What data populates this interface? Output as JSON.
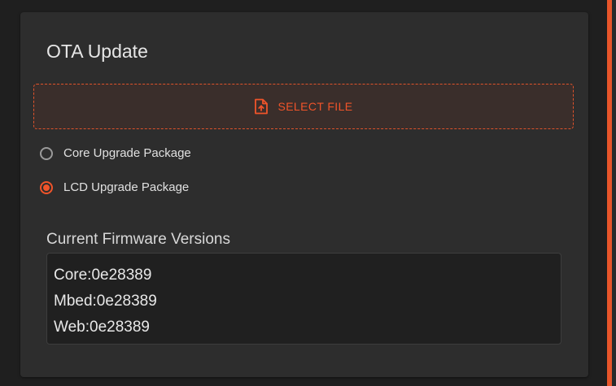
{
  "card": {
    "title": "OTA Update"
  },
  "upload": {
    "button_label": "SELECT FILE",
    "icon": "file-upload-icon"
  },
  "package_options": [
    {
      "label": "Core Upgrade Package",
      "selected": false
    },
    {
      "label": "LCD Upgrade Package",
      "selected": true
    }
  ],
  "firmware": {
    "title": "Current Firmware Versions",
    "lines": [
      "Core:0e28389",
      "Mbed:0e28389",
      "Web:0e28389"
    ]
  },
  "colors": {
    "accent": "#f0542a",
    "card_background": "#2d2d2d",
    "page_background": "#1f1f1f"
  }
}
